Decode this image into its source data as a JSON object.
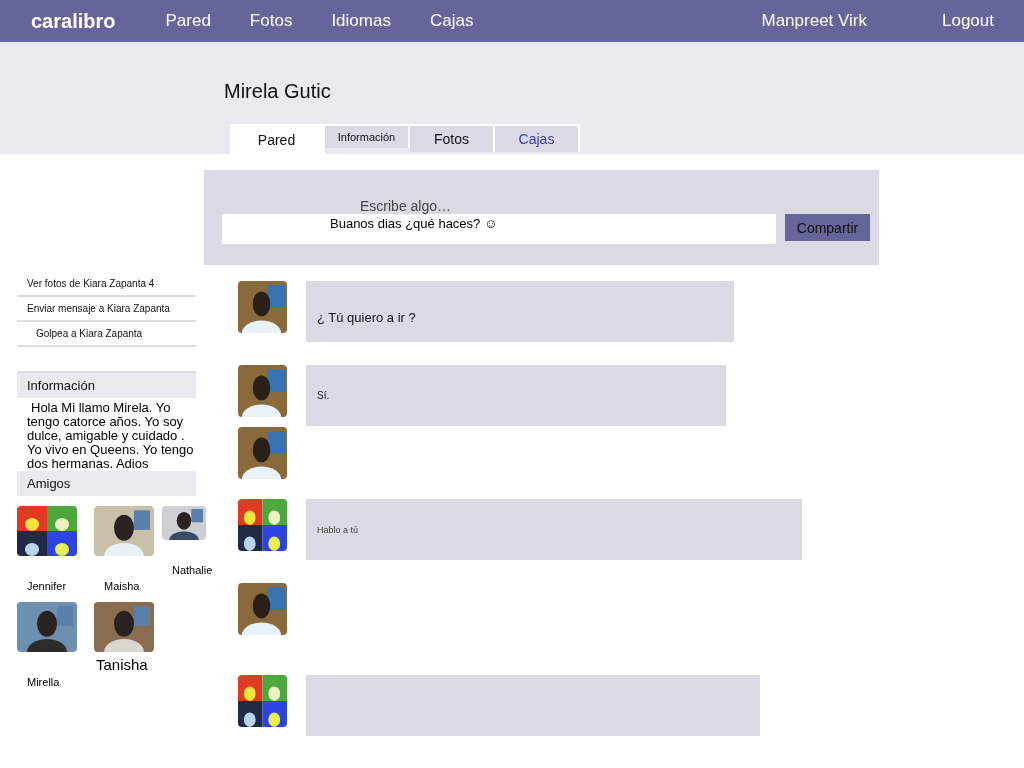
{
  "nav": {
    "logo": "caralibro",
    "links": [
      "Pared",
      "Fotos",
      "Idiomas",
      "Cajas"
    ],
    "user": "Manpreet Virk",
    "logout": "Logout"
  },
  "profile": {
    "name": "Mirela Gutic"
  },
  "tabs": [
    {
      "label": "Pared",
      "kind": "tab",
      "selected": true
    },
    {
      "label": "Información",
      "kind": "small",
      "selected": false
    },
    {
      "label": "Fotos",
      "kind": "tab",
      "selected": false
    },
    {
      "label": "Cajas",
      "kind": "link",
      "selected": false
    }
  ],
  "composer": {
    "prompt": "Escribe algo…",
    "value": "Buanos dias ¿qué haces? ☺",
    "button": "Compartir"
  },
  "actions": [
    "Ver fotos de Kiara Zapanta 4",
    "Enviar mensaje a Kiara Zapanta",
    "Golpea a Kiara Zapanta"
  ],
  "info": {
    "title": "Información",
    "text": "Hola Mi llamo Mirela. Yo tengo catorce años. Yo soy dulce, amigable y cuidado . Yo vivo en Queens. Yo tengo dos hermanas. Adios"
  },
  "friends": {
    "title": "Amigos",
    "items": [
      {
        "name": "Jennifer",
        "large": false
      },
      {
        "name": "Maisha",
        "large": false
      },
      {
        "name": "Nathalie",
        "large": false
      },
      {
        "name": "Mirella",
        "large": false
      },
      {
        "name": "Tanisha",
        "large": true
      }
    ]
  },
  "posts": [
    {
      "text": "¿ Tú quiero a ir ?",
      "bubble": true
    },
    {
      "text": "Sí.",
      "bubble": true
    },
    {
      "bubble": false
    },
    {
      "text": "Hablo a tú",
      "bubble": true
    },
    {
      "bubble": false
    },
    {
      "bubble": true
    }
  ]
}
